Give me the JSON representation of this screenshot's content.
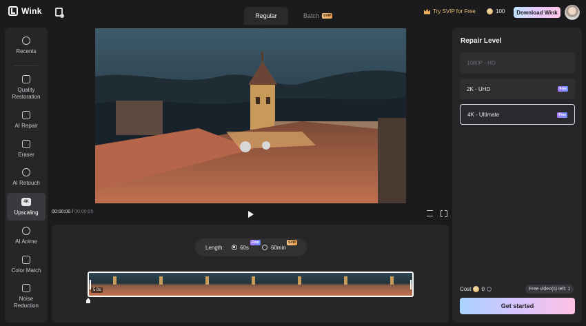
{
  "app": {
    "name": "Wink"
  },
  "header": {
    "tabs": [
      {
        "label": "Regular",
        "active": true
      },
      {
        "label": "Batch",
        "badge": "SVIP",
        "active": false
      }
    ],
    "try_svip": "Try SVIP for Free",
    "coins": "100",
    "download_label": "Download Wink"
  },
  "sidebar": {
    "items": [
      {
        "label": "Recents",
        "icon": "history-icon"
      },
      {
        "label": "Quality Restoration",
        "icon": "hd-icon"
      },
      {
        "label": "AI Repair",
        "icon": "ai-repair-icon"
      },
      {
        "label": "Eraser",
        "icon": "eraser-icon"
      },
      {
        "label": "AI Retouch",
        "icon": "retouch-icon"
      },
      {
        "label": "Upscaling",
        "icon": "4k-icon",
        "icon_text": "4K",
        "active": true
      },
      {
        "label": "AI Anime",
        "icon": "anime-icon"
      },
      {
        "label": "Color Match",
        "icon": "color-match-icon"
      },
      {
        "label": "Noise Reduction",
        "icon": "noise-icon"
      }
    ]
  },
  "player": {
    "current_time": "00:00:00",
    "separator": " / ",
    "total_time": "00:00:05"
  },
  "timeline": {
    "length_label": "Length:",
    "options": [
      {
        "label": "60s",
        "badge": "Free",
        "checked": true
      },
      {
        "label": "60min",
        "badge": "SVIP",
        "checked": false
      }
    ],
    "clip_duration": "5.0s"
  },
  "repair": {
    "title": "Repair Level",
    "levels": [
      {
        "label": "1080P - HD",
        "disabled": true
      },
      {
        "label": "2K - UHD",
        "badge": "Free"
      },
      {
        "label": "4K - Ultimate",
        "badge": "Free",
        "selected": true
      }
    ],
    "cost_label": "Cost",
    "cost_value": "0",
    "free_left": "Free video(s) left: 1",
    "get_started": "Get started"
  },
  "colors": {
    "background": "#1b1b1d",
    "panel": "#262629",
    "accent_gradient_start": "#a9d3ff",
    "accent_gradient_end": "#ffc2e2",
    "svip_gold": "#f0c27a"
  }
}
